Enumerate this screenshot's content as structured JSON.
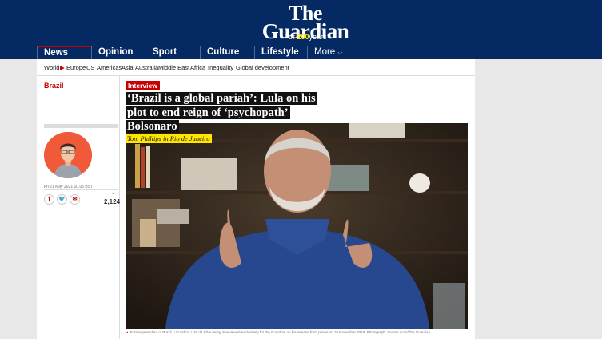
{
  "brand": {
    "the": "The",
    "guardian": "Guardian",
    "tag_prefix": "For",
    "tag_number": "200",
    "tag_suffix": "years"
  },
  "nav": [
    {
      "label": "News",
      "active": true
    },
    {
      "label": "Opinion",
      "active": false
    },
    {
      "label": "Sport",
      "active": false
    },
    {
      "label": "Culture",
      "active": false
    },
    {
      "label": "Lifestyle",
      "active": false
    },
    {
      "label": "More",
      "active": false
    }
  ],
  "subnav": [
    "World",
    "Europe",
    "US",
    "Americas",
    "Asia",
    "Australia",
    "Middle East",
    "Africa",
    "Inequality",
    "Global development"
  ],
  "article": {
    "section": "Brazil",
    "kicker": "Interview",
    "headline": "‘Brazil is a global pariah’: Lula on his plot to end reign of ‘psychopath’ Bolsonaro",
    "byline": "Tom Phillips in Rio de Janeiro",
    "dateline": "Fri 21 May 2021 10.05 BST",
    "share_count": "2,124",
    "caption": "Former president of Brazil Luiz Inácio Lula da Silva being interviewed exclusively for the Guardian on his release from prison on 19 November 2019. Photograph: Andre Lucas/The Guardian"
  },
  "colors": {
    "header": "#052962",
    "accent": "#c70000",
    "byline_bg": "#ffe500",
    "avatar_bg": "#f05a39"
  },
  "icons": {
    "share": [
      "facebook-icon",
      "twitter-icon",
      "email-icon"
    ],
    "more": "chevron-down-icon"
  }
}
